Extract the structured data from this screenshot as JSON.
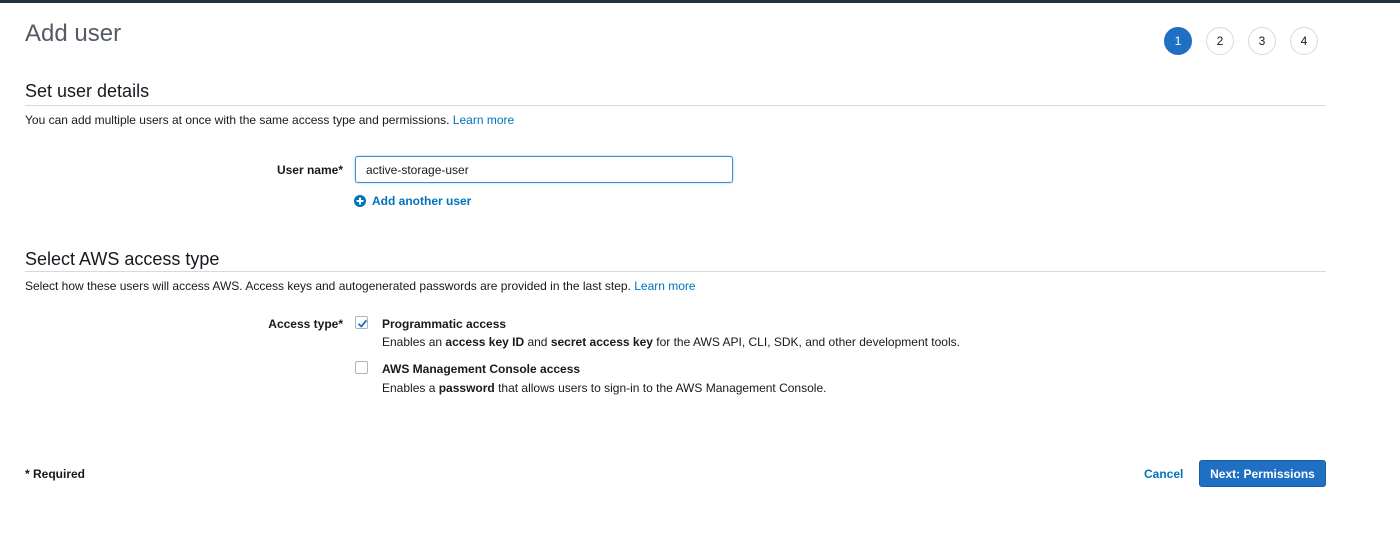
{
  "page": {
    "title": "Add user"
  },
  "steps": [
    "1",
    "2",
    "3",
    "4"
  ],
  "details": {
    "heading": "Set user details",
    "description": "You can add multiple users at once with the same access type and permissions.",
    "learn_more": "Learn more",
    "username_label": "User name*",
    "username_value": "active-storage-user",
    "add_another": "Add another user"
  },
  "access": {
    "heading": "Select AWS access type",
    "description": "Select how these users will access AWS. Access keys and autogenerated passwords are provided in the last step.",
    "learn_more": "Learn more",
    "type_label": "Access type*",
    "programmatic": {
      "title": "Programmatic access",
      "checked": true,
      "desc_1": "Enables an ",
      "desc_bold_1": "access key ID",
      "desc_2": " and ",
      "desc_bold_2": "secret access key",
      "desc_3": " for the AWS API, CLI, SDK, and other development tools."
    },
    "console": {
      "title": "AWS Management Console access",
      "checked": false,
      "desc_1": "Enables a ",
      "desc_bold_1": "password",
      "desc_2": " that allows users to sign-in to the AWS Management Console."
    }
  },
  "footer": {
    "required": "* Required",
    "cancel": "Cancel",
    "next": "Next: Permissions"
  },
  "colors": {
    "primary": "#1f6fc3",
    "link": "#0073bb",
    "check": "#1f6fc3"
  }
}
